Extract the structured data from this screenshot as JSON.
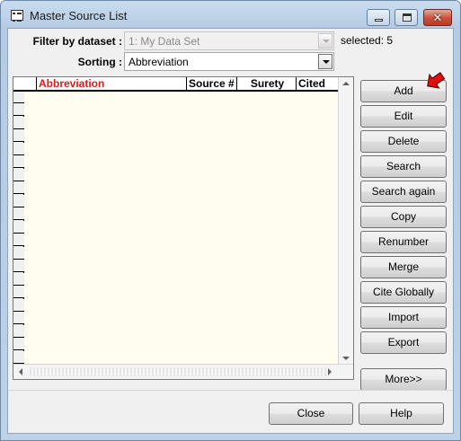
{
  "window": {
    "title": "Master Source List",
    "controls": {
      "close_glyph": "✕"
    }
  },
  "filter": {
    "label": "Filter by dataset :",
    "value": "1:  My Data Set",
    "selected_text": "selected: 5"
  },
  "sorting": {
    "label": "Sorting :",
    "value": "Abbreviation"
  },
  "grid": {
    "columns": [
      "Abbreviation",
      "Source #",
      "Surety",
      "Cited"
    ],
    "sorted_column": "Abbreviation",
    "row_count": 22
  },
  "side_buttons": [
    "Add",
    "Edit",
    "Delete",
    "Search",
    "Search again",
    "Copy",
    "Renumber",
    "Merge",
    "Cite Globally",
    "Import",
    "Export"
  ],
  "more_button": "More>>",
  "footer": {
    "close_label": "Close",
    "help_label": "Help"
  },
  "colors": {
    "sorted_header": "#d41e1e",
    "grid_background": "#fffdf0",
    "pointer_arrow": "#e01010"
  },
  "icons": {
    "app": "list-window-icon",
    "pointer": "red-arrow-pointer-icon"
  }
}
